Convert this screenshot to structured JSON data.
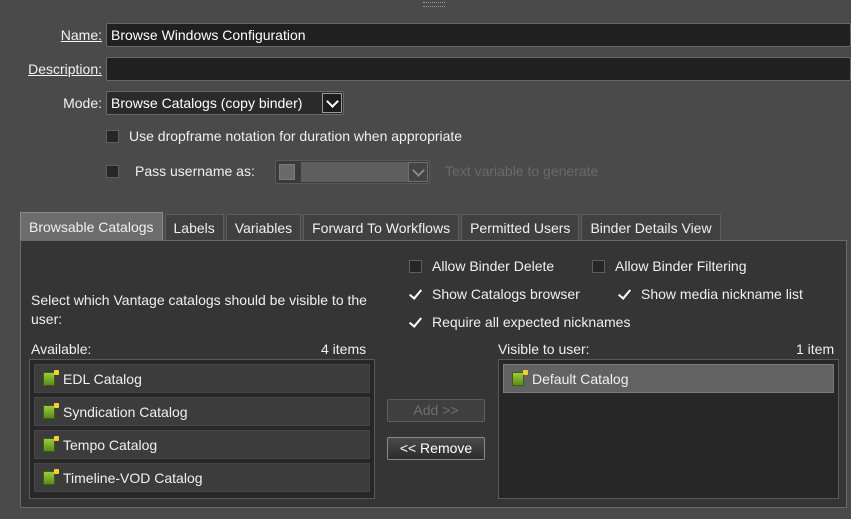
{
  "form": {
    "name_label": "Name:",
    "name_value": "Browse Windows Configuration",
    "description_label": "Description:",
    "description_value": "",
    "mode_label": "Mode:",
    "mode_value": "Browse Catalogs (copy binder)",
    "dropframe_label": "Use dropframe notation for duration when appropriate",
    "dropframe_checked": false,
    "pass_username_label": "Pass username as:",
    "pass_username_checked": false,
    "text_variable_hint": "Text variable to generate"
  },
  "tabs": [
    {
      "label": "Browsable Catalogs",
      "active": true
    },
    {
      "label": "Labels",
      "active": false
    },
    {
      "label": "Variables",
      "active": false
    },
    {
      "label": "Forward To Workflows",
      "active": false
    },
    {
      "label": "Permitted Users",
      "active": false
    },
    {
      "label": "Binder Details View",
      "active": false
    }
  ],
  "catalogs_tab": {
    "instructions": "Select which Vantage catalogs should be visible to the user:",
    "options": {
      "allow_binder_delete": {
        "label": "Allow Binder Delete",
        "checked": false
      },
      "allow_binder_filtering": {
        "label": "Allow Binder Filtering",
        "checked": false
      },
      "show_catalogs_browser": {
        "label": "Show Catalogs browser",
        "checked": true
      },
      "show_media_nickname_list": {
        "label": "Show media nickname list",
        "checked": true
      },
      "require_all_expected_nicknames": {
        "label": "Require all expected nicknames",
        "checked": true
      }
    },
    "available": {
      "label": "Available:",
      "count": "4 items",
      "items": [
        "EDL Catalog",
        "Syndication Catalog",
        "Tempo Catalog",
        "Timeline-VOD Catalog"
      ]
    },
    "visible": {
      "label": "Visible to user:",
      "count": "1 item",
      "items": [
        "Default Catalog"
      ]
    },
    "add_button": "Add >>",
    "remove_button": "<< Remove"
  },
  "colors": {
    "background": "#4a4a4a",
    "panel": "#353535",
    "input": "#202020",
    "active_tab": "#6c6c6c"
  }
}
